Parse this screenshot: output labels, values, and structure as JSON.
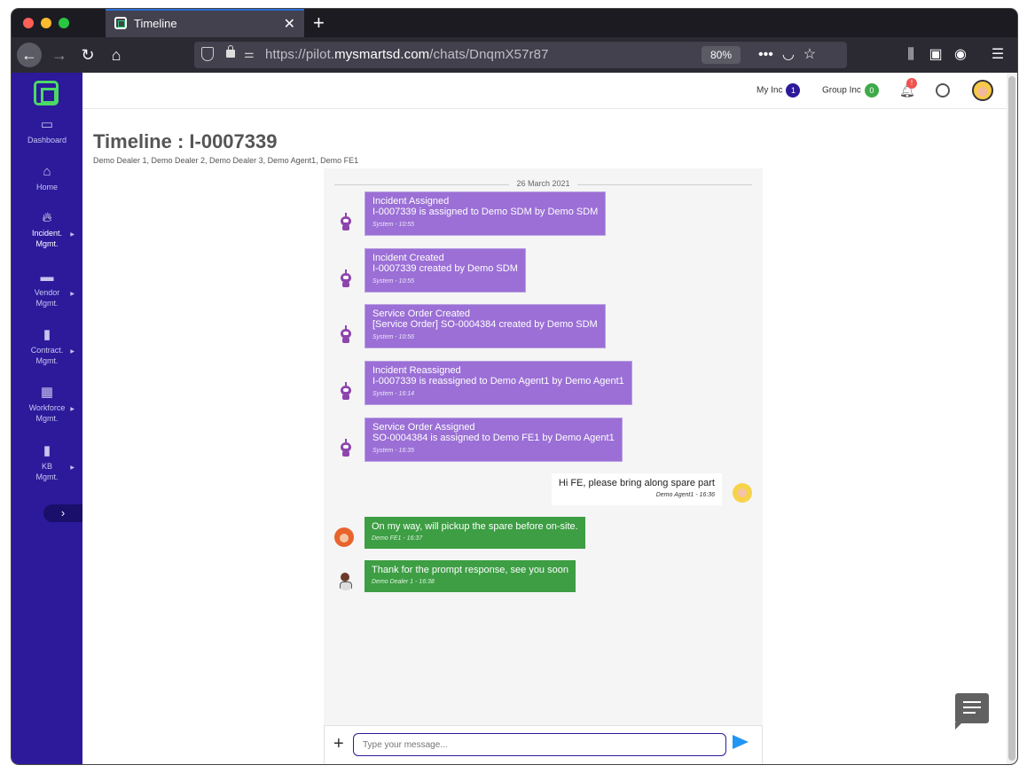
{
  "browser": {
    "tab_title": "Timeline",
    "url_prefix": "https://pilot.",
    "url_host": "mysmartsd.com",
    "url_path": "/chats/DnqmX57r87",
    "zoom": "80%"
  },
  "sidebar": {
    "items": [
      {
        "label": "Dashboard",
        "icon": "dashboard-icon"
      },
      {
        "label": "Home",
        "icon": "home-icon"
      },
      {
        "label": "Incident. Mgmt.",
        "icon": "fire-icon"
      },
      {
        "label": "Vendor Mgmt.",
        "icon": "briefcase-icon"
      },
      {
        "label": "Contract. Mgmt.",
        "icon": "document-icon"
      },
      {
        "label": "Workforce Mgmt.",
        "icon": "calendar-icon"
      },
      {
        "label": "KB Mgmt.",
        "icon": "book-icon"
      }
    ]
  },
  "header": {
    "my_inc_label": "My Inc",
    "my_inc_count": "1",
    "group_inc_label": "Group Inc",
    "group_inc_count": "0",
    "notification_badge": "!"
  },
  "page": {
    "title": "Timeline : I-0007339",
    "participants": "Demo Dealer 1, Demo Dealer 2, Demo Dealer 3, Demo Agent1, Demo FE1"
  },
  "chat": {
    "date": "26 March 2021",
    "system_messages": [
      {
        "title": "Incident Assigned",
        "text": "I-0007339 is assigned to Demo SDM by Demo SDM",
        "meta": "System - 10:55"
      },
      {
        "title": "Incident Created",
        "text": "I-0007339 created by Demo SDM",
        "meta": "System - 10:55"
      },
      {
        "title": "Service Order Created",
        "text": "[Service Order] SO-0004384 created by Demo SDM",
        "meta": "System - 10:56"
      },
      {
        "title": "Incident Reassigned",
        "text": "I-0007339 is reassigned to Demo Agent1 by Demo Agent1",
        "meta": "System - 16:14"
      },
      {
        "title": "Service Order Assigned",
        "text": "SO-0004384 is assigned to Demo FE1 by Demo Agent1",
        "meta": "System - 16:35"
      }
    ],
    "outgoing": {
      "text": "Hi FE, please bring along spare part",
      "meta": "Demo Agent1 - 16:36"
    },
    "incoming": [
      {
        "text": "On my way, will pickup the spare before on-site.",
        "meta": "Demo FE1 - 16:37"
      },
      {
        "text": "Thank for the prompt response, see you soon",
        "meta": "Demo Dealer 1 - 16:38"
      }
    ],
    "composer_placeholder": "Type your message..."
  },
  "colors": {
    "sidebar": "#2c1a9b",
    "system_bubble": "#9b6fd6",
    "incoming_bubble": "#3d9e44",
    "send_icon": "#2196f3"
  }
}
